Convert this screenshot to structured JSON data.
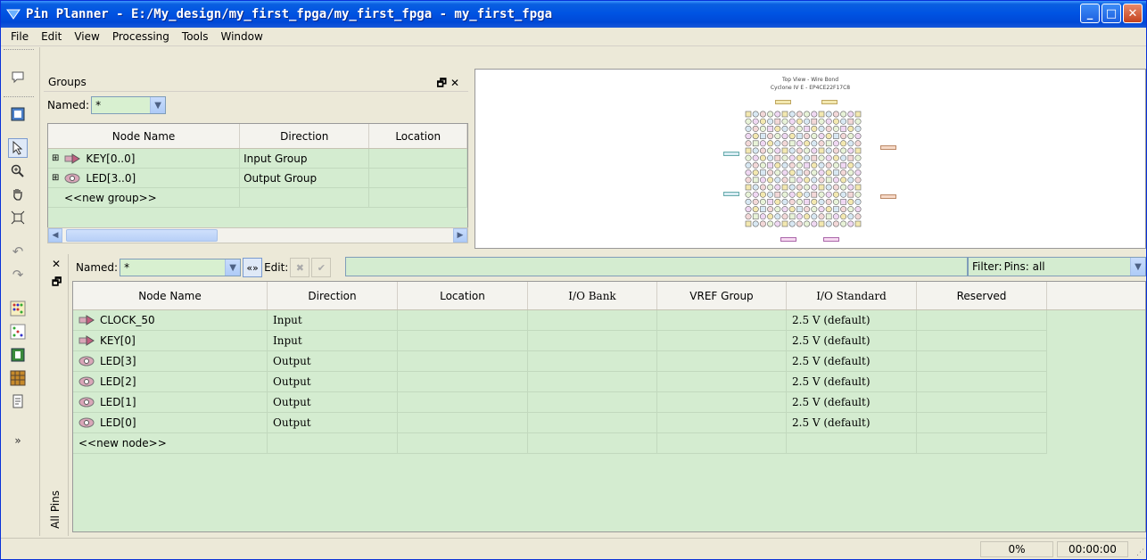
{
  "window": {
    "title": "Pin Planner - E:/My_design/my_first_fpga/my_first_fpga - my_first_fpga",
    "min_label": "_",
    "max_label": "□",
    "close_label": "✕"
  },
  "menu": [
    "File",
    "Edit",
    "View",
    "Processing",
    "Tools",
    "Window"
  ],
  "groups": {
    "title": "Groups",
    "named_label": "Named:",
    "named_value": "*",
    "columns": [
      "Node Name",
      "Direction",
      "Location"
    ],
    "rows": [
      {
        "name": "KEY[0..0]",
        "direction": "Input Group",
        "location": ""
      },
      {
        "name": "LED[3..0]",
        "direction": "Output Group",
        "location": ""
      },
      {
        "name": "<<new group>>",
        "direction": "",
        "location": ""
      }
    ]
  },
  "package": {
    "title_line1": "Top View - Wire Bond",
    "title_line2": "Cyclone IV E - EP4CE22F17C8"
  },
  "pins": {
    "tab_label": "All Pins",
    "named_label": "Named:",
    "named_value": "*",
    "edit_label": "Edit:",
    "filter_label": "Filter:",
    "filter_value": "Pins: all",
    "columns": [
      "Node Name",
      "Direction",
      "Location",
      "I/O Bank",
      "VREF Group",
      "I/O Standard",
      "Reserved"
    ],
    "rows": [
      {
        "name": "CLOCK_50",
        "direction": "Input",
        "io_standard": "2.5 V (default)",
        "type": "input"
      },
      {
        "name": "KEY[0]",
        "direction": "Input",
        "io_standard": "2.5 V (default)",
        "type": "input"
      },
      {
        "name": "LED[3]",
        "direction": "Output",
        "io_standard": "2.5 V (default)",
        "type": "output"
      },
      {
        "name": "LED[2]",
        "direction": "Output",
        "io_standard": "2.5 V (default)",
        "type": "output"
      },
      {
        "name": "LED[1]",
        "direction": "Output",
        "io_standard": "2.5 V (default)",
        "type": "output"
      },
      {
        "name": "LED[0]",
        "direction": "Output",
        "io_standard": "2.5 V (default)",
        "type": "output"
      },
      {
        "name": "<<new node>>",
        "direction": "",
        "io_standard": "",
        "type": "new"
      }
    ]
  },
  "status": {
    "progress": "0%",
    "time": "00:00:00"
  }
}
